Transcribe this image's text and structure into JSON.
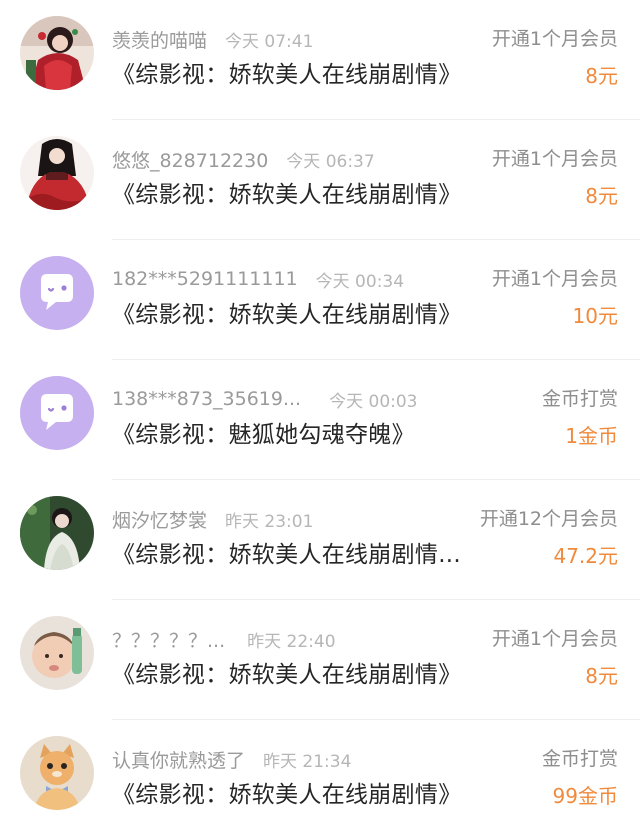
{
  "colors": {
    "amount": "#f08a3c",
    "username": "#9a9a9a",
    "time": "#b6b6b6",
    "title": "#262626",
    "default_avatar": "#c6b0f0"
  },
  "records": [
    {
      "avatar_icon": "avatar-anime-girl-red",
      "username": "羡羡的喵喵",
      "time": "今天 07:41",
      "action": "开通1个月会员",
      "title": "《综影视：娇软美人在线崩剧情》",
      "amount": "8元"
    },
    {
      "avatar_icon": "avatar-red-dress-girl",
      "username": "悠悠_828712230",
      "time": "今天 06:37",
      "action": "开通1个月会员",
      "title": "《综影视：娇软美人在线崩剧情》",
      "amount": "8元"
    },
    {
      "avatar_icon": "default-chat-bubble-avatar",
      "username": "182***5291111111",
      "time": "今天 00:34",
      "action": "开通1个月会员",
      "title": "《综影视：娇软美人在线崩剧情》",
      "amount": "10元"
    },
    {
      "avatar_icon": "default-chat-bubble-avatar",
      "username": "138***873_35619...",
      "time": "今天 00:03",
      "action": "金币打赏",
      "title": "《综影视：魅狐她勾魂夺魄》",
      "amount": "1金币"
    },
    {
      "avatar_icon": "avatar-girl-green",
      "username": "烟汐忆梦裳",
      "time": "昨天 23:01",
      "action": "开通12个月会员",
      "title": "《综影视：娇软美人在线崩剧情...",
      "amount": "47.2元"
    },
    {
      "avatar_icon": "avatar-baby",
      "username": "？？？？？...",
      "time": "昨天 22:40",
      "action": "开通1个月会员",
      "title": "《综影视：娇软美人在线崩剧情》",
      "amount": "8元"
    },
    {
      "avatar_icon": "avatar-cat",
      "username": "认真你就熟透了",
      "time": "昨天 21:34",
      "action": "金币打赏",
      "title": "《综影视：娇软美人在线崩剧情》",
      "amount": "99金币"
    }
  ]
}
